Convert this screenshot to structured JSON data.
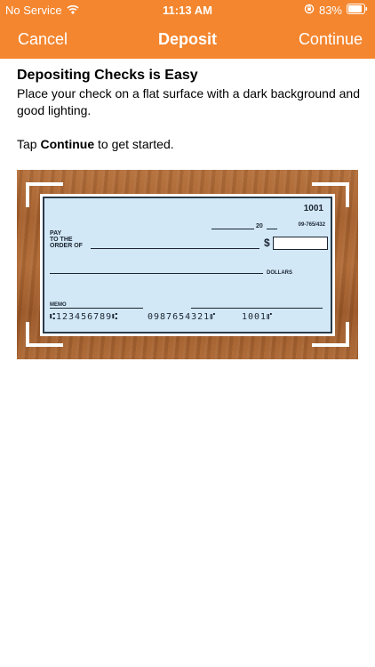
{
  "status_bar": {
    "carrier": "No Service",
    "time": "11:13 AM",
    "battery": "83%",
    "icons": [
      "wifi-icon",
      "orientation-lock-icon",
      "battery-icon"
    ]
  },
  "nav": {
    "cancel_label": "Cancel",
    "title": "Deposit",
    "continue_label": "Continue"
  },
  "content": {
    "heading": "Depositing Checks is Easy",
    "instruction": "Place your check on a flat surface with a dark background and good lighting.",
    "tap_prefix": "Tap ",
    "tap_bold": "Continue",
    "tap_suffix": " to get started."
  },
  "check": {
    "number": "1001",
    "date_suffix": "20",
    "routing_fraction": "09-765/432",
    "pay_label_1": "PAY",
    "pay_label_2": "TO THE",
    "pay_label_3": "ORDER OF",
    "dollar_sign": "$",
    "dollars_label": "DOLLARS",
    "memo_label": "MEMO",
    "micr_1": "⑆123456789⑆",
    "micr_2": "0987654321⑈",
    "micr_3": "1001⑈"
  },
  "colors": {
    "accent": "#f4862f",
    "check_background": "#d2e8f7",
    "wood": "#a55f2c"
  }
}
